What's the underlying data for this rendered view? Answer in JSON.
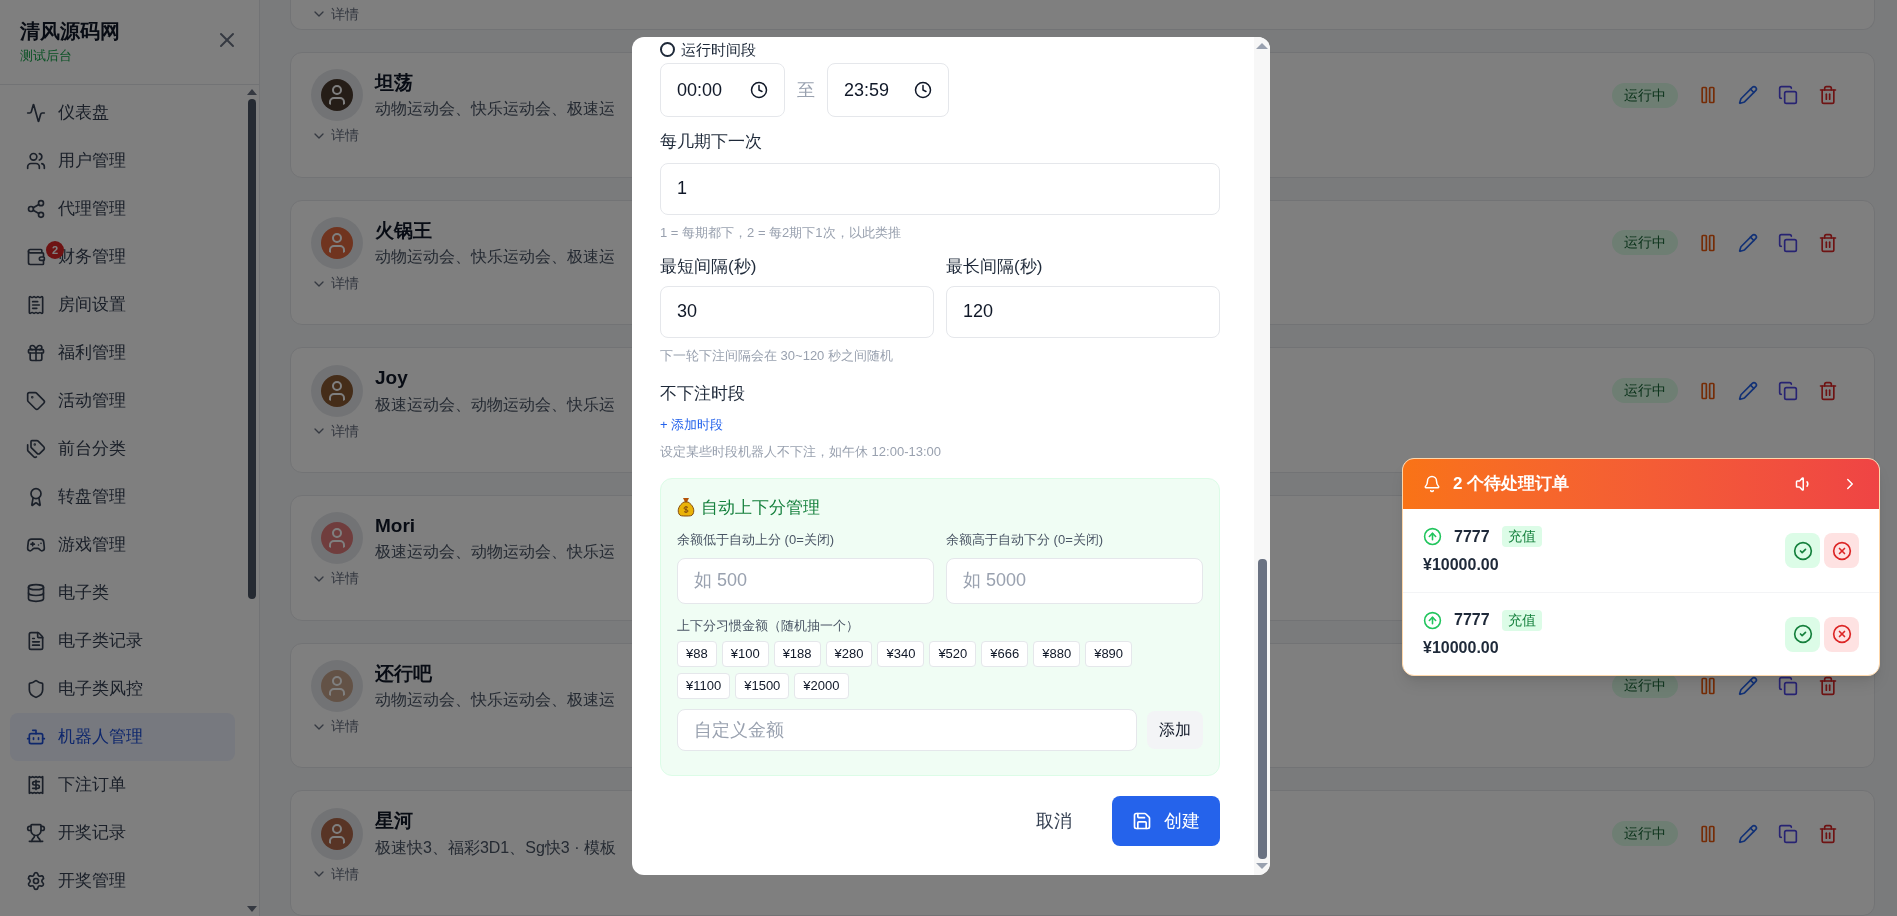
{
  "sidebar": {
    "title": "清风源码网",
    "subtitle": "测试后台",
    "items": [
      {
        "label": "仪表盘",
        "selected": false
      },
      {
        "label": "用户管理",
        "selected": false
      },
      {
        "label": "代理管理",
        "selected": false
      },
      {
        "label": "财务管理",
        "selected": false,
        "badge": "2"
      },
      {
        "label": "房间设置",
        "selected": false
      },
      {
        "label": "福利管理",
        "selected": false
      },
      {
        "label": "活动管理",
        "selected": false
      },
      {
        "label": "前台分类",
        "selected": false
      },
      {
        "label": "转盘管理",
        "selected": false
      },
      {
        "label": "游戏管理",
        "selected": false
      },
      {
        "label": "电子类",
        "selected": false
      },
      {
        "label": "电子类记录",
        "selected": false
      },
      {
        "label": "电子类风控",
        "selected": false
      },
      {
        "label": "机器人管理",
        "selected": true
      },
      {
        "label": "下注订单",
        "selected": false
      },
      {
        "label": "开奖记录",
        "selected": false
      },
      {
        "label": "开奖管理",
        "selected": false
      }
    ]
  },
  "robots": [
    {
      "detail": "详情"
    },
    {
      "name": "坦荡",
      "games": "动物运动会、快乐运动会、极速运",
      "detail": "详情",
      "status": "运行中"
    },
    {
      "name": "火锅王",
      "games": "动物运动会、快乐运动会、极速运",
      "detail": "详情",
      "status": "运行中"
    },
    {
      "name": "Joy",
      "games": "极速运动会、动物运动会、快乐运",
      "detail": "详情",
      "status": "运行中"
    },
    {
      "name": "Mori",
      "games": "极速运动会、动物运动会、快乐运",
      "detail": "详情"
    },
    {
      "name": "还行吧",
      "games": "动物运动会、快乐运动会、极速运",
      "detail": "详情",
      "status": "运行中"
    },
    {
      "name": "星河",
      "games": "极速快3、福彩3D1、Sg快3 · 模板",
      "detail": "详情",
      "status": "运行中"
    }
  ],
  "modal": {
    "run_period_checked": false,
    "run_period_label": "运行时间段",
    "start_time": "00:00",
    "to": "至",
    "end_time": "23:59",
    "every_label": "每几期下一次",
    "every_value": "1",
    "every_hint": "1 = 每期都下，2 = 每2期下1次，以此类推",
    "min_label": "最短间隔(秒)",
    "min_value": "30",
    "max_label": "最长间隔(秒)",
    "max_value": "120",
    "interval_hint": "下一轮下注间隔会在 30~120 秒之间随机",
    "pause_label": "不下注时段",
    "add_period": "+ 添加时段",
    "pause_hint": "设定某些时段机器人不下注，如午休 12:00-13:00",
    "auto": {
      "title": "自动上下分管理",
      "low_label": "余额低于自动上分 (0=关闭)",
      "low_placeholder": "如 500",
      "high_label": "余额高于自动下分 (0=关闭)",
      "high_placeholder": "如 5000",
      "amounts_label": "上下分习惯金额（随机抽一个）",
      "amounts": [
        "¥88",
        "¥100",
        "¥188",
        "¥280",
        "¥340",
        "¥520",
        "¥666",
        "¥880",
        "¥890",
        "¥1100",
        "¥1500",
        "¥2000"
      ],
      "custom_placeholder": "自定义金额",
      "add_button": "添加"
    },
    "cancel": "取消",
    "create": "创建"
  },
  "notification": {
    "title": "2 个待处理订单",
    "orders": [
      {
        "user": "7777",
        "tag": "充值",
        "amount": "¥10000.00"
      },
      {
        "user": "7777",
        "tag": "充值",
        "amount": "¥10000.00"
      }
    ]
  }
}
